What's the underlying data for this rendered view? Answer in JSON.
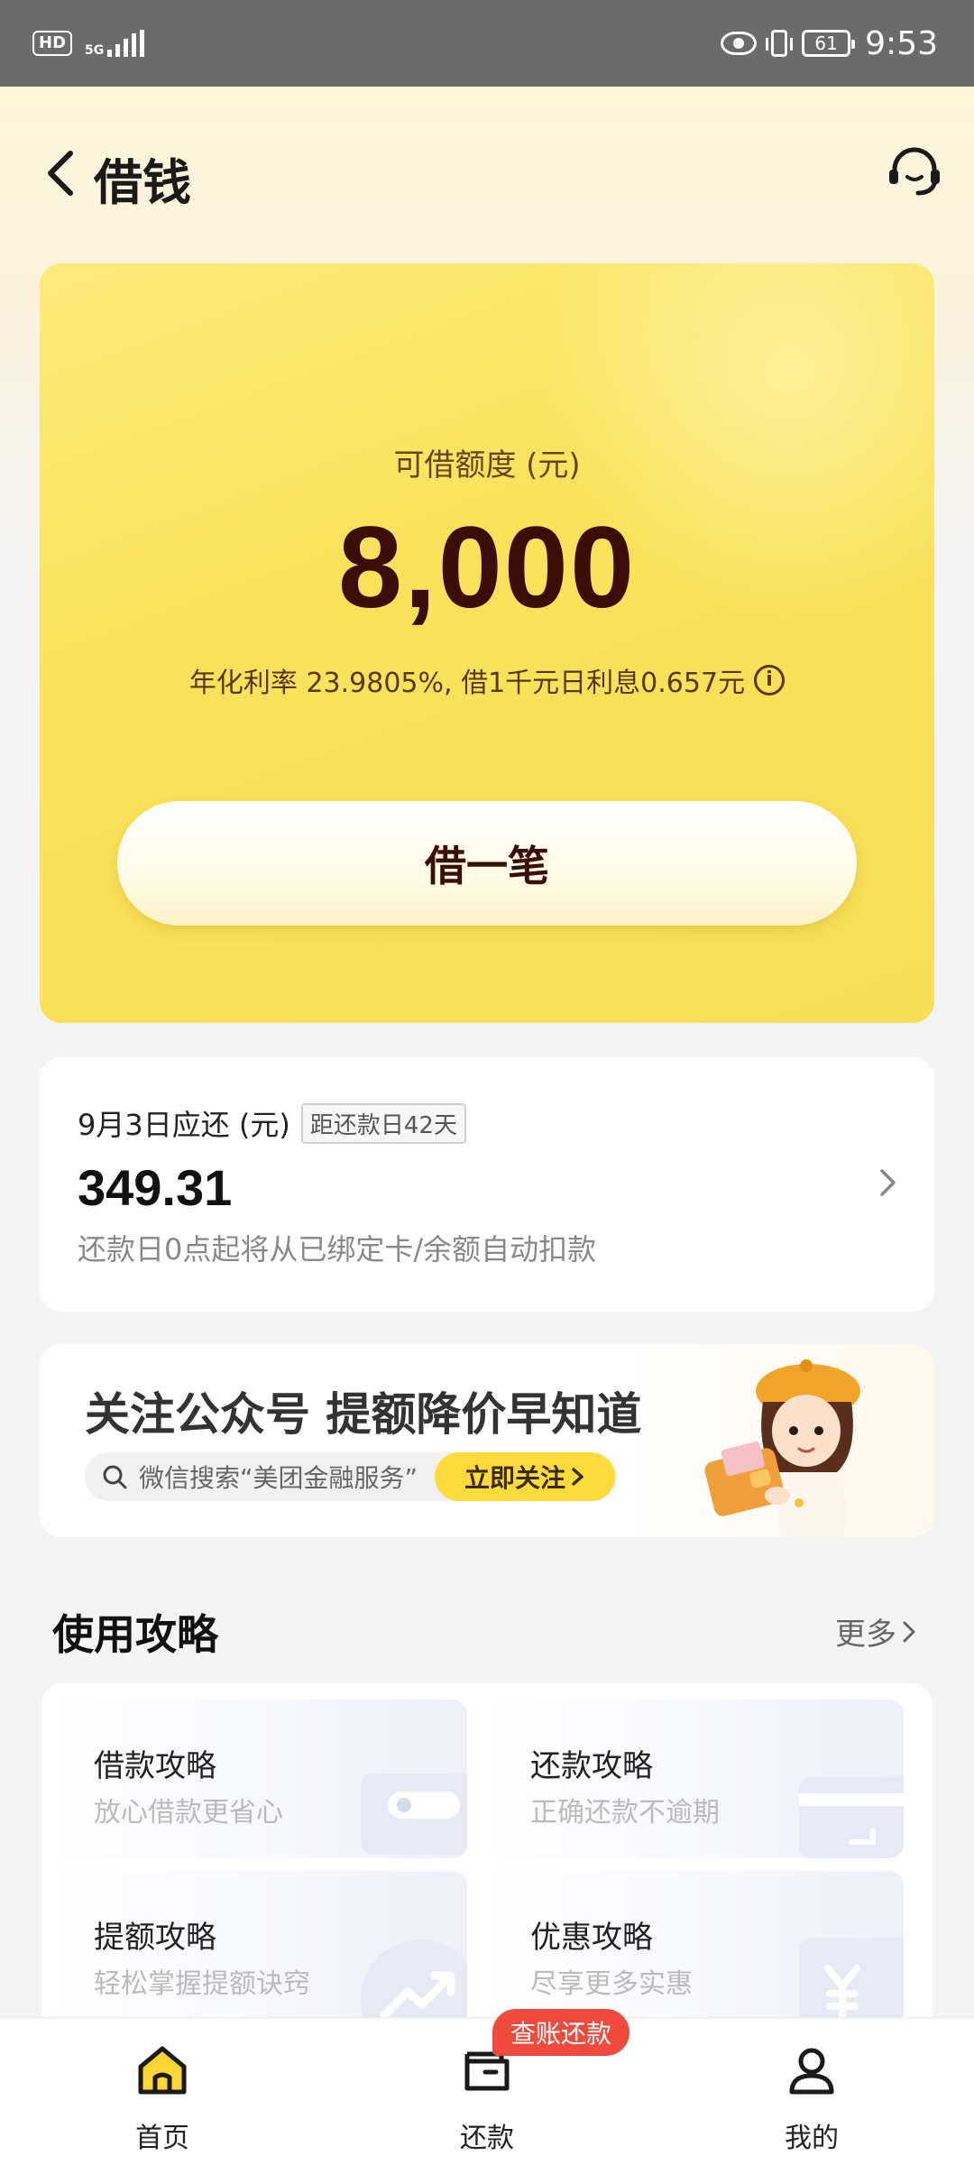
{
  "status_bar": {
    "hd": "HD",
    "network": "5G",
    "battery": "61",
    "time": "9:53"
  },
  "header": {
    "title": "借钱"
  },
  "credit": {
    "label": "可借额度 (元)",
    "amount": "8,000",
    "rate_text": "年化利率 23.9805%, 借1千元日利息0.657元",
    "borrow_button": "借一笔"
  },
  "repay": {
    "due_label": "9月3日应还 (元)",
    "days_badge": "距还款日42天",
    "amount": "349.31",
    "note": "还款日0点起将从已绑定卡/余额自动扣款"
  },
  "banner": {
    "title": "关注公众号 提额降价早知道",
    "search_text": "微信搜索“美团金融服务”",
    "follow_button": "立即关注"
  },
  "guide": {
    "title": "使用攻略",
    "more": "更多",
    "items": [
      {
        "title": "借款攻略",
        "subtitle": "放心借款更省心"
      },
      {
        "title": "还款攻略",
        "subtitle": "正确还款不逾期"
      },
      {
        "title": "提额攻略",
        "subtitle": "轻松掌握提额诀窍"
      },
      {
        "title": "优惠攻略",
        "subtitle": "尽享更多实惠"
      }
    ]
  },
  "bottom_nav": {
    "items": [
      {
        "label": "首页"
      },
      {
        "label": "还款"
      },
      {
        "label": "我的"
      }
    ],
    "badge": "查账还款"
  },
  "colors": {
    "accent_yellow": "#fbe25a",
    "dark_brown": "#3a0d06",
    "badge_red": "#f04a3c"
  }
}
